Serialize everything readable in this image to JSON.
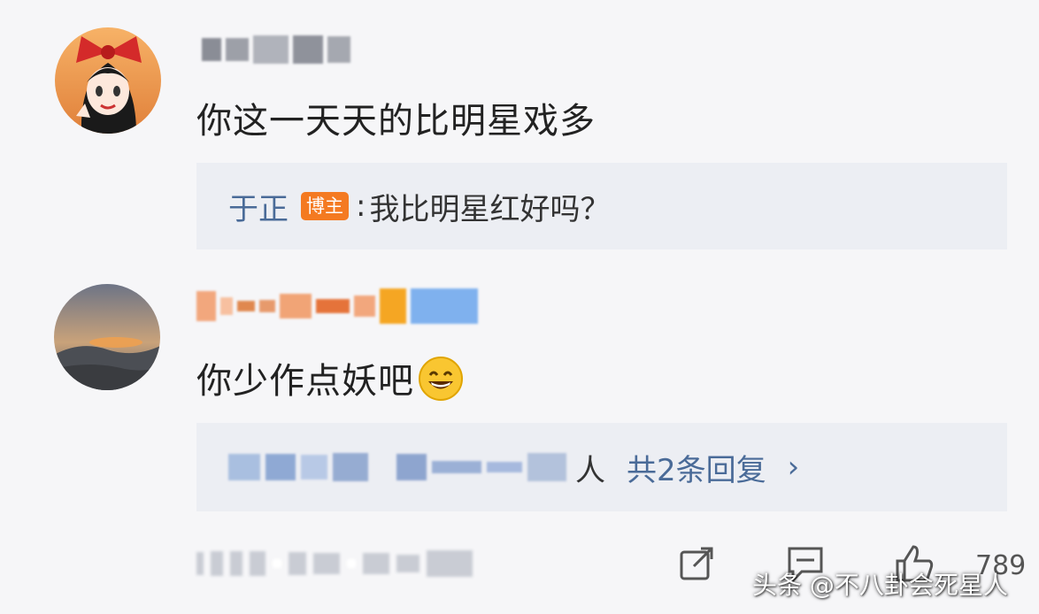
{
  "comment1": {
    "avatar_icon": "anime-girl-red-bow-avatar-icon",
    "text": "你这一天天的比明星戏多",
    "reply": {
      "author": "于正",
      "badge": "博主",
      "separator": ":",
      "text": "我比明星红好吗？"
    }
  },
  "comment2": {
    "avatar_icon": "sunset-mountain-avatar-icon",
    "text": "你少作点妖吧",
    "emoji": "grinning-face-icon",
    "replies_summary": {
      "suffix": "人",
      "more_label": "共2条回复",
      "chevron": "›"
    }
  },
  "footer": {
    "share_icon": "share-icon",
    "comment_icon": "comment-icon",
    "like_icon": "thumbs-up-icon",
    "like_count": "789"
  },
  "watermark": "头条 @不八卦会死星人",
  "colors": {
    "link": "#4a6b98",
    "badge": "#f47a21",
    "reply_bg": "#eceef3",
    "page_bg": "#f6f6f8"
  }
}
